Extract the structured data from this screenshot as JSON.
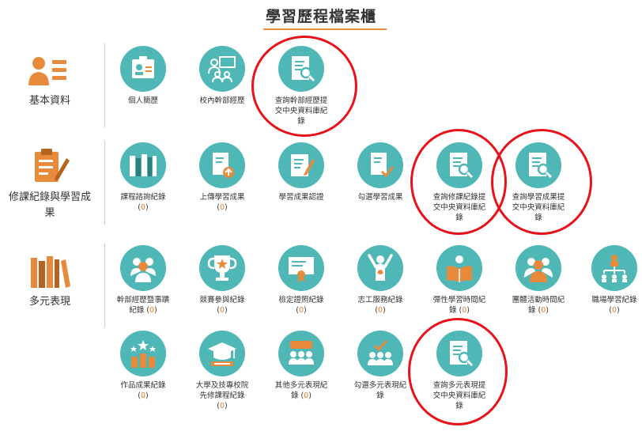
{
  "page": {
    "title": "學習歷程檔案櫃"
  },
  "sections": {
    "basic": {
      "label": "基本資料"
    },
    "course": {
      "label_line1": "修課紀錄與學習成",
      "label_line2": "果"
    },
    "diverse": {
      "label": "多元表現"
    }
  },
  "items": {
    "resume": {
      "label": "個人簡歷"
    },
    "campus_cadre": {
      "label": "校內幹部經歷"
    },
    "query_cadre": {
      "line1": "查詢幹部經歷提",
      "line2": "交中央資料庫紀",
      "line3": "錄"
    },
    "course_record": {
      "label": "課程諮詢紀錄",
      "count": "0"
    },
    "upload_result": {
      "label": "上傳學習成果",
      "count": "0"
    },
    "verify_result": {
      "label": "學習成果認證"
    },
    "select_result": {
      "label": "勾選學習成果"
    },
    "query_course": {
      "line1": "查詢修課紀錄提",
      "line2": "交中央資料庫紀",
      "line3": "錄"
    },
    "query_result": {
      "line1": "查詢學習成果提",
      "line2": "交中央資料庫紀",
      "line3": "錄"
    },
    "cadre_events": {
      "label": "幹部經歷暨事蹟",
      "line2": "紀錄",
      "count": "0"
    },
    "competition": {
      "label": "競賽參與紀錄",
      "count": "0"
    },
    "license": {
      "label": "檢定證照紀錄",
      "count": "0"
    },
    "volunteer": {
      "label": "志工服務紀錄",
      "count": "0"
    },
    "flexible": {
      "label": "彈性學習時間紀",
      "line2": "錄",
      "count": "0"
    },
    "group_activity": {
      "label": "團體活動時間紀",
      "line2": "錄",
      "count": "0"
    },
    "workplace": {
      "label": "職場學習紀錄",
      "count": "0"
    },
    "works": {
      "label": "作品成果紀錄",
      "count": "0"
    },
    "college_pre": {
      "line1": "大學及技專校院",
      "line2": "先修課程紀錄",
      "count": "0"
    },
    "other_diverse": {
      "label": "其他多元表現紀",
      "line2": "錄",
      "count": "0"
    },
    "select_diverse": {
      "line1": "勾選多元表現紀",
      "line2": "錄"
    },
    "query_diverse": {
      "line1": "查詢多元表現提",
      "line2": "交中央資料庫紀",
      "line3": "錄"
    }
  },
  "colors": {
    "teal": "#4fb8b6",
    "orange": "#e88a3c",
    "highlight_red": "#e8121b"
  },
  "icons": {
    "basic": "person-card-icon",
    "course": "clipboard-pencil-icon",
    "diverse": "books-icon",
    "resume": "id-badge-icon",
    "campus_cadre": "team-board-icon",
    "query": "document-search-icon",
    "course_record": "books-shelf-icon",
    "upload": "document-upload-icon",
    "verify": "document-pencil-icon",
    "select": "document-check-icon",
    "cadre_events": "group-icon",
    "competition": "trophy-icon",
    "license": "certificate-icon",
    "volunteer": "raised-hands-icon",
    "flexible": "reading-icon",
    "group_activity": "people-icon",
    "workplace": "org-chart-icon",
    "works": "stars-bars-icon",
    "college_pre": "graduation-cap-icon",
    "other_diverse": "audience-icon",
    "select_diverse": "audience-check-icon"
  }
}
